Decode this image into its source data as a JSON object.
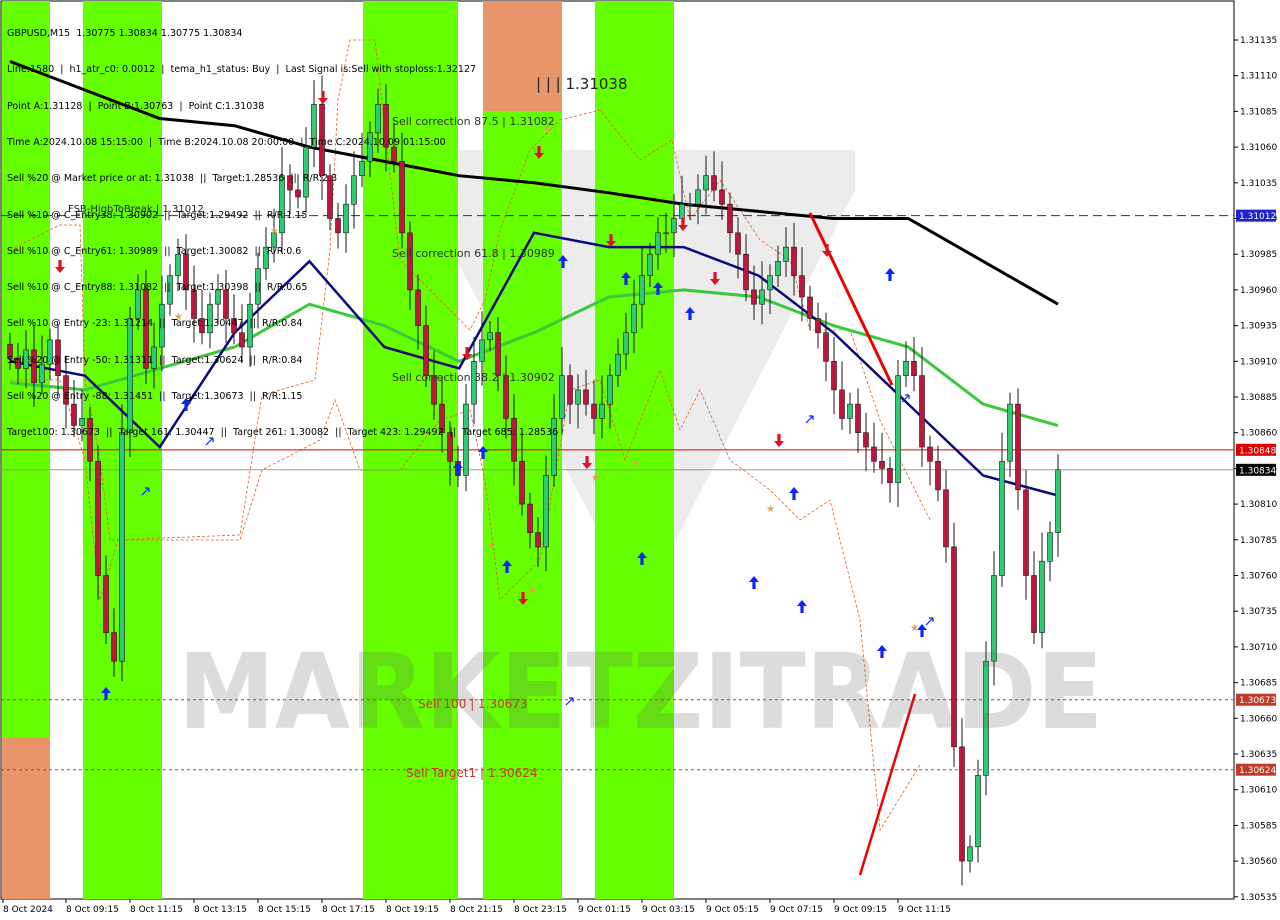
{
  "header": {
    "symbol": "GBPUSD,M15",
    "ohlc": "1.30775 1.30834 1.30775 1.30834"
  },
  "info_lines": [
    "Line:1580  |  h1_atr_c0: 0.0012  |  tema_h1_status: Buy  |  Last Signal is:Sell with stoploss:1.32127",
    "Point A:1.31128  |  Point B:1.30763  |  Point C:1.31038",
    "Time A:2024.10.08 15:15:00  |  Time B:2024.10.08 20:00:00  |  Time C:2024.10.09 01:15:00",
    "Sell %20 @ Market price or at: 1.31038  ||  Target:1.28536  ||  R/R:2.3",
    "Sell %10 @ C_Entry38: 1.30902  ||  Target:1.29492  ||  R/R:1.15",
    "Sell %10 @ C_Entry61: 1.30989  ||  Target:1.30082  ||  R/R:0.6",
    "Sell %10 @ C_Entry88: 1.31082  ||  Target:1.30398  ||  R/R:0.65",
    "Sell %10 @ Entry -23: 1.31214  ||  Target:1.30447  ||  R/R:0.84",
    "Sell %20 @ Entry -50: 1.31311  ||  Target:1.30624  ||  R/R:0.84",
    "Sell %20 @ Entry -88: 1.31451  ||  Target:1.30673  ||  R/R:1.15",
    "Target100: 1.30673  ||  Target 161: 1.30447  ||  Target 261: 1.30082  ||  Target 423: 1.29492  ||  Target 685: 1.28536"
  ],
  "chart_labels": {
    "point_c": "| | | 1.31038",
    "sell_correction_875": "Sell correction 87.5 | 1.31082",
    "sell_correction_618": "Sell correction 61.8 | 1.30989",
    "sell_correction_382": "Sell correction 38.2 | 1.30902",
    "fsb_high": "FSB-HighToBreak  |  1.31012",
    "sell_100": "Sell 100 | 1.30673",
    "sell_target1": "Sell Target1 | 1.30624",
    "watermark": "MARKETZITRADE"
  },
  "colors": {
    "bull_candle": "#2ecc71",
    "bear_candle": "#c0143c",
    "zone_green": "#66ff00",
    "zone_orange": "#e8956a",
    "ma_black": "#000000",
    "ma_navy": "#0a0a80",
    "ma_green": "#3cc83c",
    "fsb_line": "#2222cc",
    "bid_line": "#e00000",
    "target_line": "#c0392b",
    "trend_red": "#ee0000",
    "buy_arrow": "#0b24ff",
    "sell_arrow": "#e01020",
    "star": "#e0a060"
  },
  "chart_data": {
    "type": "candlestick",
    "symbol": "GBPUSD",
    "timeframe": "M15",
    "ylim": [
      1.30535,
      1.3131
    ],
    "y_ticks": [
      "1.31135",
      "1.31110",
      "1.31085",
      "1.31060",
      "1.31035",
      "1.31010",
      "1.30985",
      "1.30960",
      "1.30935",
      "1.30910",
      "1.30885",
      "1.30860",
      "1.30835",
      "1.30810",
      "1.30785",
      "1.30760",
      "1.30735",
      "1.30710",
      "1.30685",
      "1.30660",
      "1.30635",
      "1.30610",
      "1.30585",
      "1.30560",
      "1.30535"
    ],
    "x_ticks": [
      "8 Oct 2024",
      "8 Oct 09:15",
      "8 Oct 11:15",
      "8 Oct 13:15",
      "8 Oct 15:15",
      "8 Oct 17:15",
      "8 Oct 19:15",
      "8 Oct 21:15",
      "8 Oct 23:15",
      "9 Oct 01:15",
      "9 Oct 03:15",
      "9 Oct 05:15",
      "9 Oct 07:15",
      "9 Oct 09:15",
      "9 Oct 11:15"
    ],
    "price_tags": [
      {
        "label": "1.31012",
        "value": 1.31012,
        "color": "#2222cc"
      },
      {
        "label": "1.30848",
        "value": 1.30848,
        "color": "#e00000"
      },
      {
        "label": "1.30834",
        "value": 1.30834,
        "color": "#000000"
      },
      {
        "label": "1.30673",
        "value": 1.30673,
        "color": "#c0392b"
      },
      {
        "label": "1.30624",
        "value": 1.30624,
        "color": "#c0392b"
      }
    ],
    "levels": [
      {
        "name": "FSB-HighToBreak",
        "value": 1.31012
      },
      {
        "name": "Bid",
        "value": 1.30848
      },
      {
        "name": "Sell 100",
        "value": 1.30673
      },
      {
        "name": "Sell Target1",
        "value": 1.30624
      }
    ],
    "closes": [
      1.30912,
      1.30905,
      1.30918,
      1.30895,
      1.30908,
      1.30925,
      1.309,
      1.3088,
      1.30865,
      1.3087,
      1.3084,
      1.3076,
      1.3072,
      1.307,
      1.3086,
      1.3094,
      1.3096,
      1.30905,
      1.3092,
      1.3095,
      1.3097,
      1.30985,
      1.3096,
      1.3094,
      1.3093,
      1.3095,
      1.3096,
      1.3094,
      1.3093,
      1.3092,
      1.3095,
      1.30975,
      1.3099,
      1.31,
      1.3104,
      1.3103,
      1.31025,
      1.3106,
      1.3109,
      1.3104,
      1.3101,
      1.31,
      1.3102,
      1.3104,
      1.3105,
      1.3107,
      1.3109,
      1.3106,
      1.3105,
      1.31,
      1.3096,
      1.30935,
      1.309,
      1.3088,
      1.3086,
      1.3084,
      1.3083,
      1.3088,
      1.3091,
      1.30925,
      1.3093,
      1.309,
      1.3087,
      1.3084,
      1.3081,
      1.3079,
      1.3078,
      1.3083,
      1.3087,
      1.309,
      1.3088,
      1.3089,
      1.3088,
      1.3087,
      1.3088,
      1.309,
      1.30915,
      1.3093,
      1.3095,
      1.3097,
      1.30985,
      1.31,
      1.31,
      1.3101,
      1.3102,
      1.3102,
      1.3103,
      1.3104,
      1.3103,
      1.3102,
      1.31,
      1.30985,
      1.3096,
      1.3095,
      1.3096,
      1.3097,
      1.3098,
      1.3099,
      1.3097,
      1.30955,
      1.3094,
      1.3093,
      1.3091,
      1.3089,
      1.3087,
      1.3088,
      1.3086,
      1.3085,
      1.3084,
      1.30835,
      1.30825,
      1.309,
      1.3091,
      1.309,
      1.3085,
      1.3084,
      1.3082,
      1.3078,
      1.3064,
      1.3056,
      1.3057,
      1.3062,
      1.307,
      1.3076,
      1.3084,
      1.3088,
      1.3082,
      1.3076,
      1.3072,
      1.3077,
      1.3079,
      1.30834
    ],
    "ma_black": [
      1.3112,
      1.311,
      1.3108,
      1.31075,
      1.3106,
      1.3105,
      1.3104,
      1.31035,
      1.31028,
      1.3102,
      1.31015,
      1.3101,
      1.3101,
      1.3098,
      1.3095
    ],
    "ma_navy": [
      1.3091,
      1.309,
      1.3085,
      1.3093,
      1.3098,
      1.3092,
      1.30905,
      1.31,
      1.3099,
      1.3099,
      1.3097,
      1.3093,
      1.3088,
      1.3083,
      1.30816
    ],
    "ma_green": [
      1.30895,
      1.3089,
      1.30905,
      1.3092,
      1.3095,
      1.30935,
      1.3091,
      1.3093,
      1.30955,
      1.3096,
      1.30955,
      1.30935,
      1.3092,
      1.3088,
      1.30865
    ]
  }
}
